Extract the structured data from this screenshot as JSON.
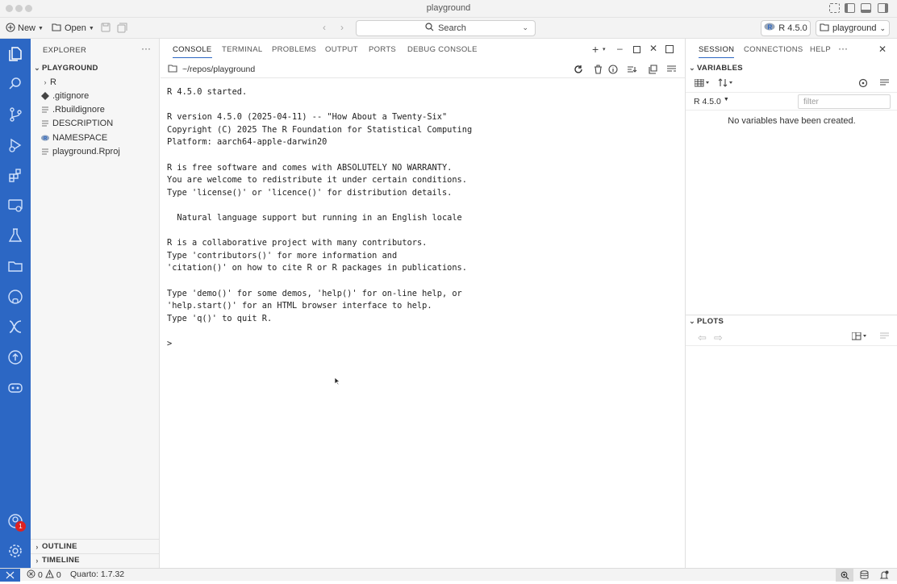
{
  "window": {
    "title": "playground"
  },
  "toolbar": {
    "new_label": "New",
    "open_label": "Open",
    "search_label": "Search",
    "runtime_label": "R 4.5.0",
    "project_label": "playground"
  },
  "activity_bar": {
    "icons": [
      "explorer-icon",
      "search-icon",
      "source-control-icon",
      "run-debug-icon",
      "extensions-icon",
      "remote-explorer-icon",
      "testing-icon",
      "folder-icon",
      "github-icon",
      "connections-icon",
      "publish-icon",
      "copilot-icon",
      "account-icon",
      "settings-icon"
    ],
    "account_badge": "1"
  },
  "explorer": {
    "header": "EXPLORER",
    "root": "PLAYGROUND",
    "items": [
      {
        "label": "R",
        "kind": "folder"
      },
      {
        "label": ".gitignore",
        "kind": "git"
      },
      {
        "label": ".Rbuildignore",
        "kind": "text"
      },
      {
        "label": "DESCRIPTION",
        "kind": "text"
      },
      {
        "label": "NAMESPACE",
        "kind": "r"
      },
      {
        "label": "playground.Rproj",
        "kind": "text"
      }
    ],
    "outline": "OUTLINE",
    "timeline": "TIMELINE"
  },
  "console": {
    "tabs": [
      "CONSOLE",
      "TERMINAL",
      "PROBLEMS",
      "OUTPUT",
      "PORTS",
      "DEBUG CONSOLE"
    ],
    "active_tab": "CONSOLE",
    "path": "~/repos/playground",
    "output": "R 4.5.0 started.\n\nR version 4.5.0 (2025-04-11) -- \"How About a Twenty-Six\"\nCopyright (C) 2025 The R Foundation for Statistical Computing\nPlatform: aarch64-apple-darwin20\n\nR is free software and comes with ABSOLUTELY NO WARRANTY.\nYou are welcome to redistribute it under certain conditions.\nType 'license()' or 'licence()' for distribution details.\n\n  Natural language support but running in an English locale\n\nR is a collaborative project with many contributors.\nType 'contributors()' for more information and\n'citation()' on how to cite R or R packages in publications.\n\nType 'demo()' for some demos, 'help()' for on-line help, or\n'help.start()' for an HTML browser interface to help.\nType 'q()' to quit R.\n\n>"
  },
  "session": {
    "tabs": [
      "SESSION",
      "CONNECTIONS",
      "HELP"
    ],
    "active_tab": "SESSION",
    "variables_header": "VARIABLES",
    "env_label": "R 4.5.0",
    "filter_placeholder": "filter",
    "empty_message": "No variables have been created.",
    "plots_header": "PLOTS"
  },
  "status_bar": {
    "errors": "0",
    "warnings": "0",
    "quarto": "Quarto: 1.7.32"
  },
  "colors": {
    "accent": "#2c67c4",
    "badge": "#dd2222"
  }
}
